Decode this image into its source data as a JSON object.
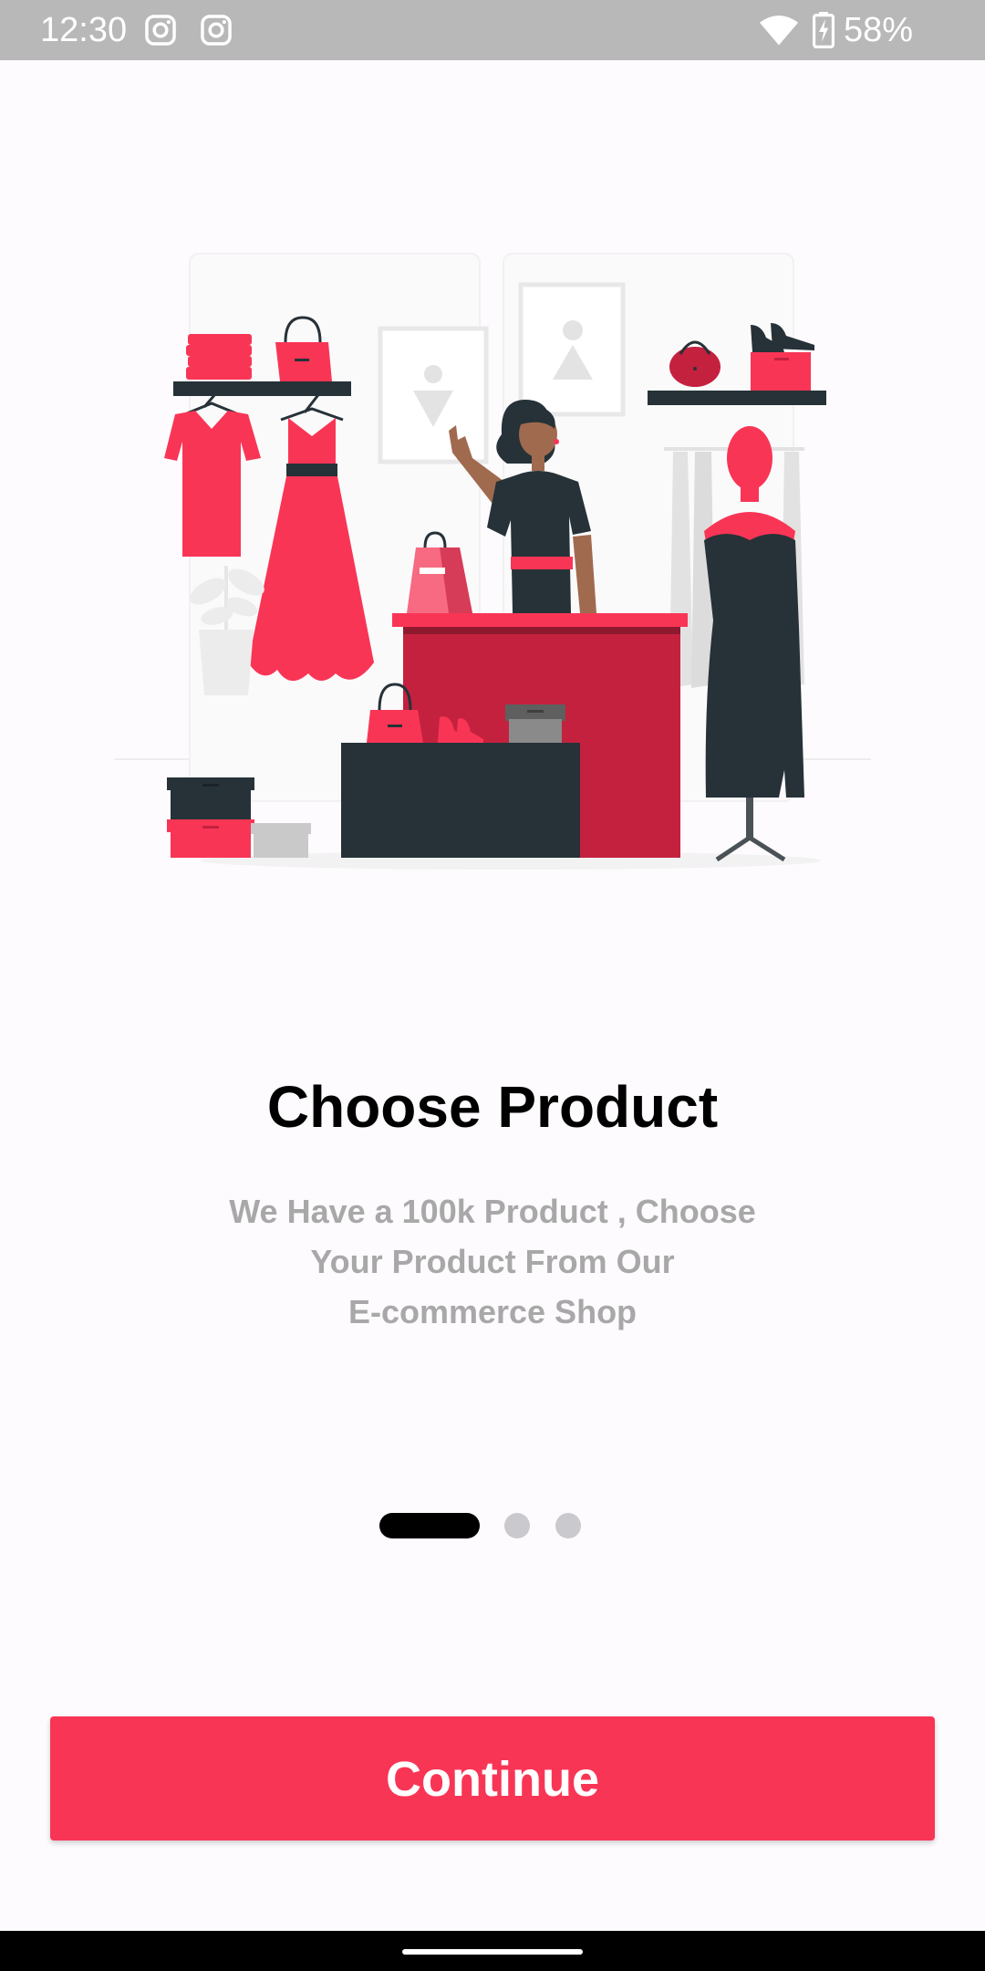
{
  "status_bar": {
    "time": "12:30",
    "battery": "58%",
    "icons": [
      "instagram-icon",
      "instagram-icon",
      "wifi-icon",
      "battery-charging-icon"
    ]
  },
  "onboarding": {
    "illustration": "shop-illustration",
    "title": "Choose Product",
    "subtitle": "We Have a 100k Product , Choose\nYour Product From  Our\nE-commerce Shop",
    "page_count": 3,
    "current_page": 1
  },
  "actions": {
    "continue_label": "Continue"
  },
  "colors": {
    "accent": "#f93556",
    "dark": "#263238",
    "subtitle": "#a9a8a9",
    "status_bar": "#b9b8b8"
  }
}
